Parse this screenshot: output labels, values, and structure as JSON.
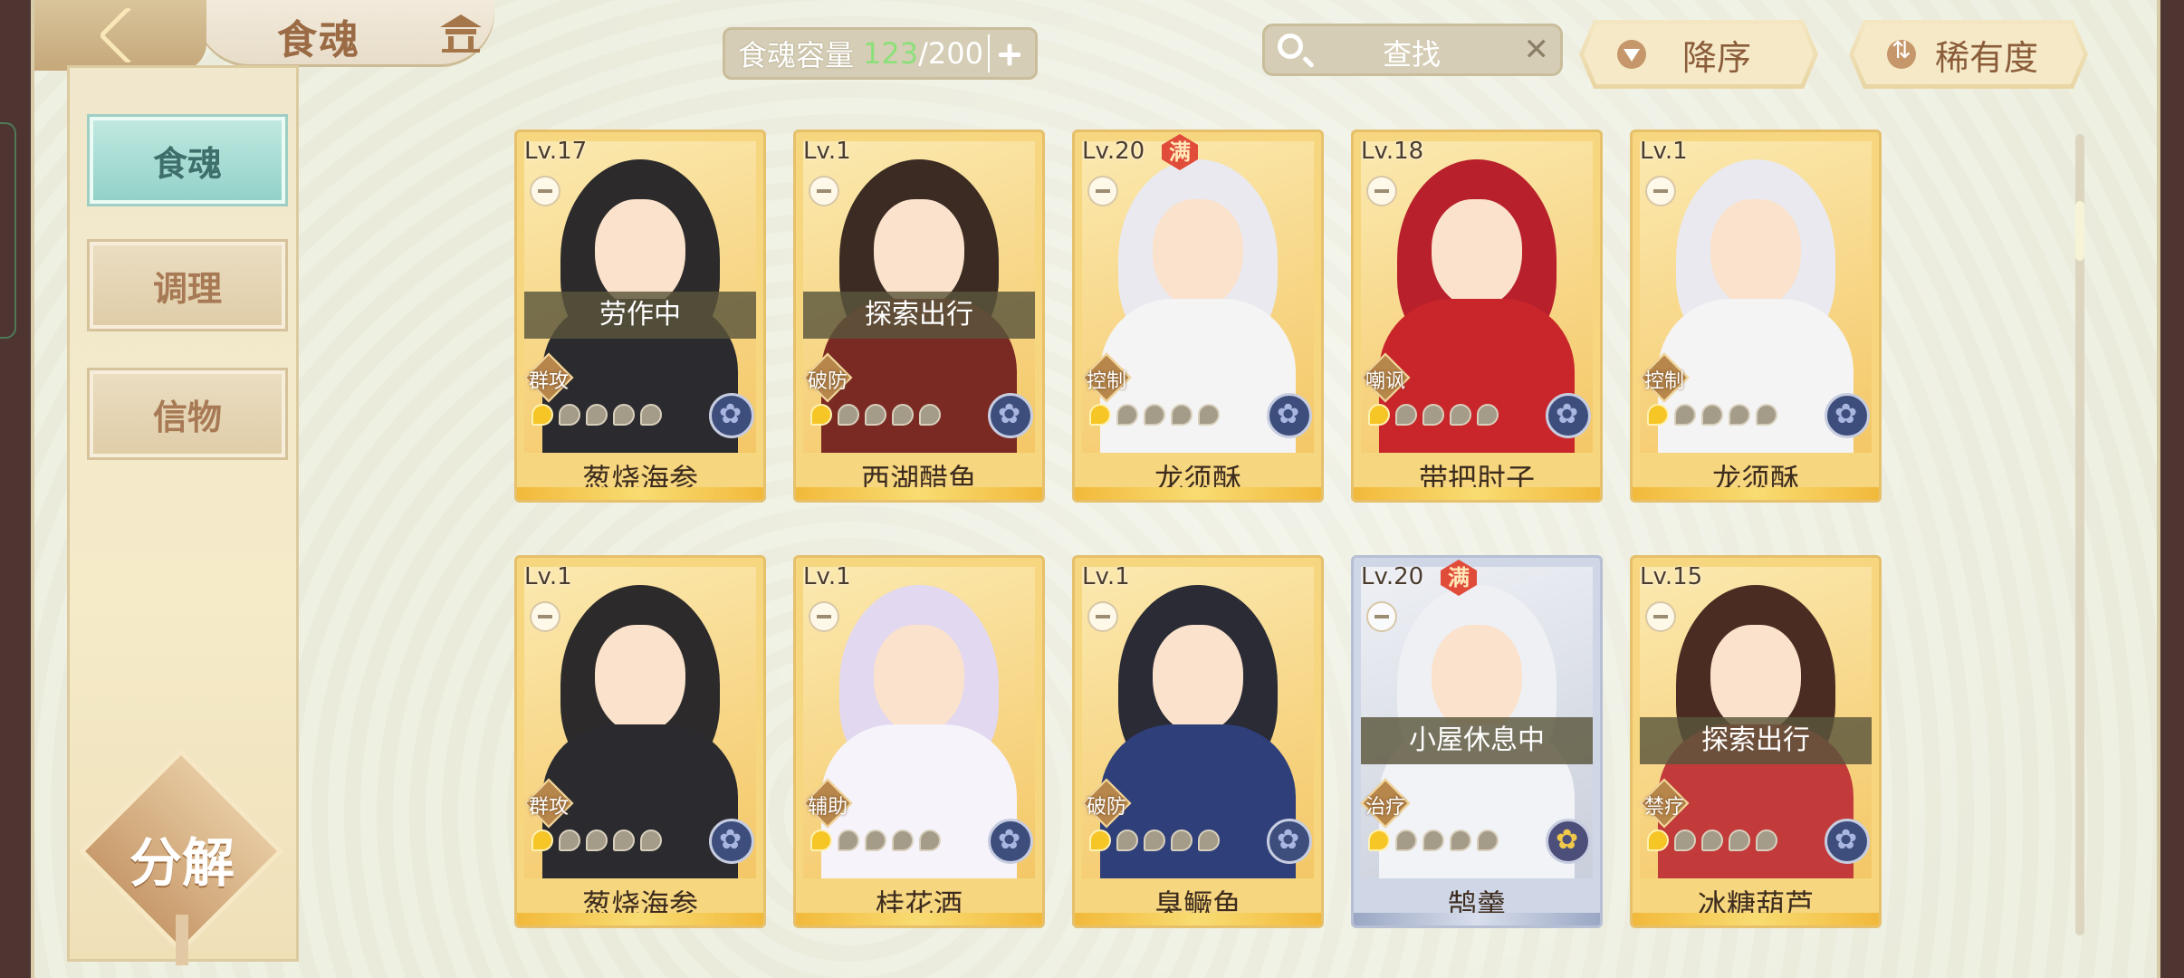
{
  "header": {
    "title": "食魂",
    "back_icon": "back-chevron-icon",
    "home_icon": "pavilion-icon"
  },
  "capacity": {
    "label": "食魂容量",
    "current": "123",
    "separator": "/",
    "max": "200",
    "current_color": "#8be07a"
  },
  "search": {
    "placeholder": "查找",
    "clear_glyph": "✕"
  },
  "sort": {
    "order_label": "降序",
    "rarity_label": "稀有度"
  },
  "sidebar": {
    "items": [
      {
        "label": "食魂",
        "active": true
      },
      {
        "label": "调理",
        "active": false
      },
      {
        "label": "信物",
        "active": false
      }
    ],
    "decompose_label": "分解"
  },
  "cards": [
    {
      "level": "Lv.17",
      "name": "葱烧海参",
      "role": "群攻",
      "status": "劳作中",
      "full": "",
      "stars": 1,
      "frame": "gold"
    },
    {
      "level": "Lv.1",
      "name": "西湖醋鱼",
      "role": "破防",
      "status": "探索出行",
      "full": "",
      "stars": 1,
      "frame": "gold"
    },
    {
      "level": "Lv.20",
      "name": "龙须酥",
      "role": "控制",
      "status": "",
      "full": "满",
      "stars": 1,
      "frame": "gold"
    },
    {
      "level": "Lv.18",
      "name": "带把肘子",
      "role": "嘲讽",
      "status": "",
      "full": "",
      "stars": 1,
      "frame": "gold"
    },
    {
      "level": "Lv.1",
      "name": "龙须酥",
      "role": "控制",
      "status": "",
      "full": "",
      "stars": 1,
      "frame": "gold"
    },
    {
      "level": "Lv.1",
      "name": "葱烧海参",
      "role": "群攻",
      "status": "",
      "full": "",
      "stars": 1,
      "frame": "gold"
    },
    {
      "level": "Lv.1",
      "name": "桂花酒",
      "role": "辅助",
      "status": "",
      "full": "",
      "stars": 1,
      "frame": "gold"
    },
    {
      "level": "Lv.1",
      "name": "臭鳜鱼",
      "role": "破防",
      "status": "",
      "full": "",
      "stars": 1,
      "frame": "gold"
    },
    {
      "level": "Lv.20",
      "name": "鹄羹",
      "role": "治疗",
      "status": "小屋休息中",
      "full": "满",
      "stars": 1,
      "frame": "silver"
    },
    {
      "level": "Lv.15",
      "name": "冰糖葫芦",
      "role": "禁疗",
      "status": "探索出行",
      "full": "",
      "stars": 1,
      "frame": "gold"
    }
  ]
}
